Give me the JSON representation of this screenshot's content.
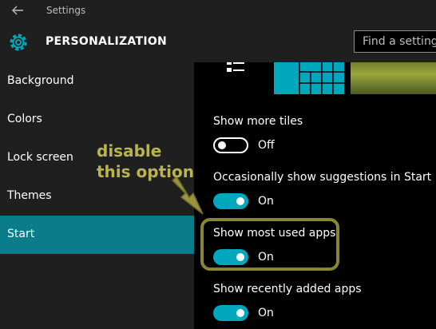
{
  "window": {
    "title": "Settings"
  },
  "header": {
    "section_title": "PERSONALIZATION",
    "search_placeholder": "Find a setting"
  },
  "sidebar": {
    "items": [
      {
        "label": "Background",
        "active": false
      },
      {
        "label": "Colors",
        "active": false
      },
      {
        "label": "Lock screen",
        "active": false
      },
      {
        "label": "Themes",
        "active": false
      },
      {
        "label": "Start",
        "active": true
      }
    ]
  },
  "main": {
    "settings": [
      {
        "label": "Show more tiles",
        "state": "Off"
      },
      {
        "label": "Occasionally show suggestions in Start",
        "state": "On"
      },
      {
        "label": "Show most used apps",
        "state": "On"
      },
      {
        "label": "Show recently added apps",
        "state": "On"
      }
    ]
  },
  "annotation": {
    "text": "disable\nthis option"
  },
  "colors": {
    "accent": "#00a7bd",
    "active_nav": "#0a7d8a",
    "annotation": "#b9b350",
    "panel": "#1f1f1f"
  }
}
